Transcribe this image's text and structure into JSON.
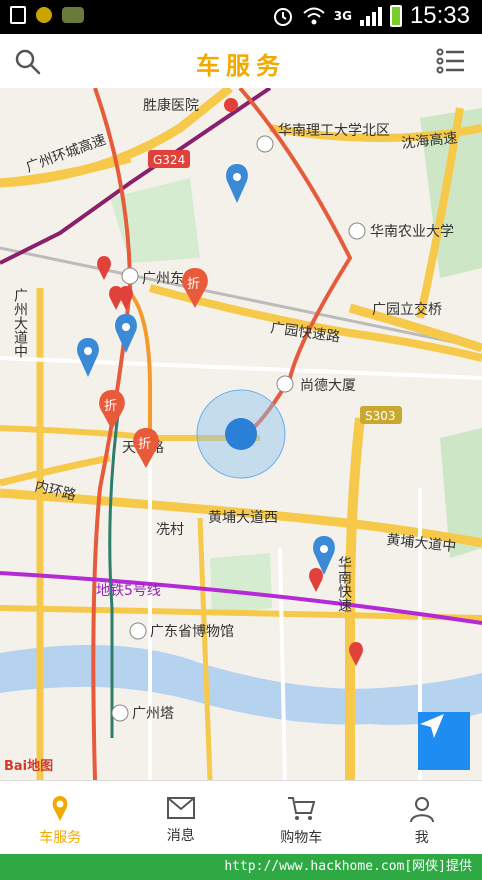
{
  "status_bar": {
    "time": "15:33",
    "network": "3G"
  },
  "header": {
    "title": "车服务"
  },
  "map": {
    "labels": {
      "hospital": "胜康医院",
      "scut": "华南理工大学北区",
      "ring_hw": "广州环城高速",
      "shahai": "沈海高速",
      "g324": "G324",
      "scau": "华南农业大学",
      "station": "广州东站",
      "guangzhou_ave": "广州大道中",
      "guangyuan_interchange": "广园立交桥",
      "guangyuan_ex": "广园快速路",
      "shangde": "尚德大厦",
      "s303": "S303",
      "tianhe_rd": "天河路",
      "inner_ring": "内环路",
      "huangpu_west": "黄埔大道西",
      "huangpu_mid": "黄埔大道中",
      "xiancun": "冼村",
      "huanan_ex": "华南快速",
      "metro5": "地铁5号线",
      "museum": "广东省博物馆",
      "canton_tower": "广州塔",
      "discount": "折"
    },
    "logo_text": "Bai地图"
  },
  "tabs": [
    {
      "label": "车服务",
      "icon": "location-pin-icon",
      "active": true
    },
    {
      "label": "消息",
      "icon": "envelope-icon",
      "active": false
    },
    {
      "label": "购物车",
      "icon": "shopping-cart-icon",
      "active": false
    },
    {
      "label": "我",
      "icon": "user-icon",
      "active": false
    }
  ],
  "footer": {
    "text": "http://www.hackhome.com[网侠]提供"
  },
  "colors": {
    "accent": "#f2a900",
    "locate_button": "#1e8cf0",
    "footer_bar": "#2ea944"
  }
}
